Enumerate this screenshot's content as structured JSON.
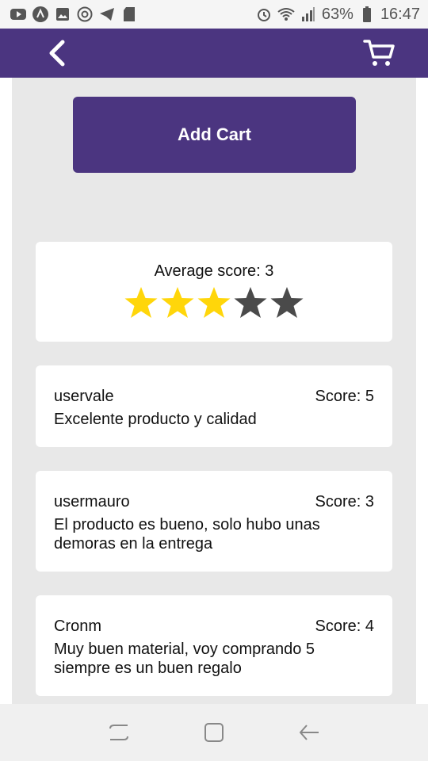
{
  "colors": {
    "brand": "#4b3580",
    "star_filled": "#ffd60a",
    "star_empty": "#4a4a4a"
  },
  "status_bar": {
    "left_icons": [
      "youtube-icon",
      "arc-icon",
      "image-icon",
      "chrome-icon",
      "telegram-icon",
      "sd-card-icon"
    ],
    "right_icons": [
      "alarm-icon",
      "wifi-icon",
      "signal-icon",
      "battery-icon"
    ],
    "battery": "63%",
    "time": "16:47"
  },
  "app_bar": {
    "back_icon": "chevron-left-icon",
    "cart_icon": "cart-icon"
  },
  "add_cart_label": "Add Cart",
  "average": {
    "label": "Average score: 3",
    "score": 3,
    "max": 5
  },
  "reviews": [
    {
      "user": "uservale",
      "score": "Score: 5",
      "text": "Excelente producto y calidad"
    },
    {
      "user": "usermauro",
      "score": "Score: 3",
      "text": "El producto es bueno, solo hubo unas demoras en la entrega"
    },
    {
      "user": "Cronm",
      "score": "Score: 4",
      "text": "Muy buen material, voy comprando 5 siempre es un buen regalo"
    }
  ],
  "nav_bar": {
    "icons": [
      "recent-apps-icon",
      "home-icon",
      "back-icon"
    ]
  }
}
